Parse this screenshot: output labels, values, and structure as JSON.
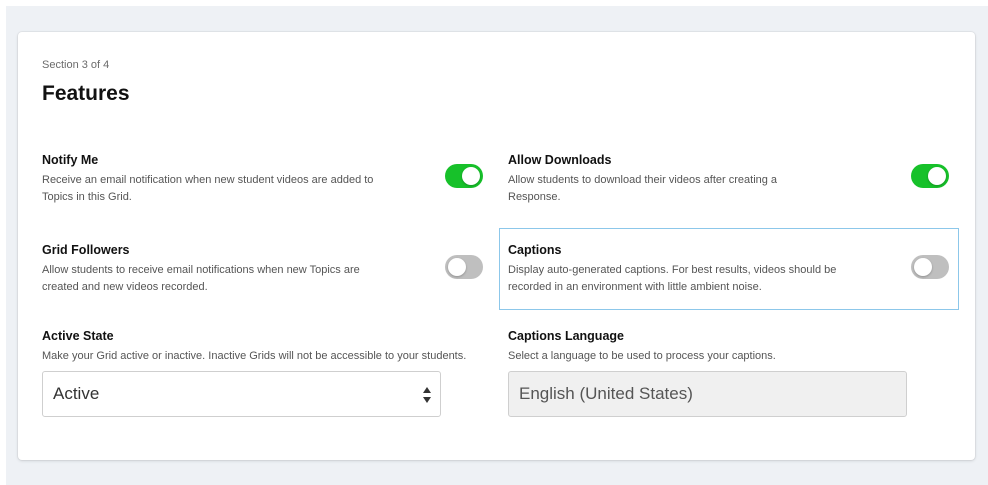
{
  "section_label": "Section 3 of 4",
  "title": "Features",
  "features": {
    "notify_me": {
      "title": "Notify Me",
      "desc": "Receive an email notification when new student videos are added to Topics in this Grid.",
      "enabled": true
    },
    "allow_downloads": {
      "title": "Allow Downloads",
      "desc": "Allow students to download their videos after creating a Response.",
      "enabled": true
    },
    "grid_followers": {
      "title": "Grid Followers",
      "desc": "Allow students to receive email notifications when new Topics are created and new videos recorded.",
      "enabled": false
    },
    "captions": {
      "title": "Captions",
      "desc": "Display auto-generated captions. For best results, videos should be recorded in an environment with little ambient noise.",
      "enabled": false
    }
  },
  "active_state": {
    "title": "Active State",
    "desc": "Make your Grid active or inactive. Inactive Grids will not be accessible to your students.",
    "value": "Active"
  },
  "captions_language": {
    "title": "Captions Language",
    "desc": "Select a language to be used to process your captions.",
    "value": "English (United States)"
  },
  "colors": {
    "toggle_on": "#17c12a",
    "toggle_off": "#bfbfbf",
    "focus_border": "#8cc7ea"
  },
  "icons": {
    "select_arrows": "updown-arrows-icon"
  }
}
